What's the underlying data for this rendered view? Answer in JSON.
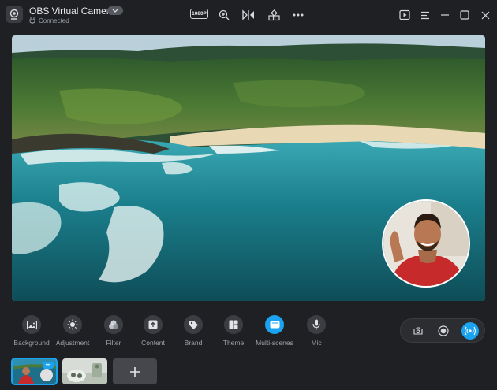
{
  "window": {
    "title": "OBS Virtual Camera",
    "status": "Connected",
    "resolution": "1080P"
  },
  "toolbar": {
    "icons": [
      "resolution-icon",
      "zoom-in-icon",
      "mirror-icon",
      "layout-icon",
      "more-icon"
    ],
    "right_icons": [
      "play-icon",
      "menu-icon",
      "minimize-icon",
      "maximize-icon",
      "close-icon"
    ]
  },
  "tools": [
    {
      "id": "background",
      "label": "Background",
      "icon": "image-icon"
    },
    {
      "id": "adjustment",
      "label": "Adjustment",
      "icon": "sun-icon"
    },
    {
      "id": "filter",
      "label": "Filter",
      "icon": "filter-icon"
    },
    {
      "id": "content",
      "label": "Content",
      "icon": "upload-icon"
    },
    {
      "id": "brand",
      "label": "Brand",
      "icon": "tag-icon"
    },
    {
      "id": "theme",
      "label": "Theme",
      "icon": "theme-icon"
    },
    {
      "id": "multi-scenes",
      "label": "Multi-scenes",
      "icon": "scenes-icon",
      "active": true
    },
    {
      "id": "mic",
      "label": "Mic",
      "icon": "mic-icon"
    }
  ],
  "recording": {
    "buttons": [
      "camera-icon",
      "record-icon",
      "live-icon"
    ],
    "active": "live-icon"
  },
  "scenes": {
    "items": [
      {
        "name": "scene-1",
        "selected": true,
        "badge": "•••"
      },
      {
        "name": "scene-2",
        "selected": false
      }
    ],
    "add_label": "+"
  },
  "colors": {
    "accent": "#1aa3f0",
    "background": "#1f2023",
    "panel": "#2b2d31"
  }
}
